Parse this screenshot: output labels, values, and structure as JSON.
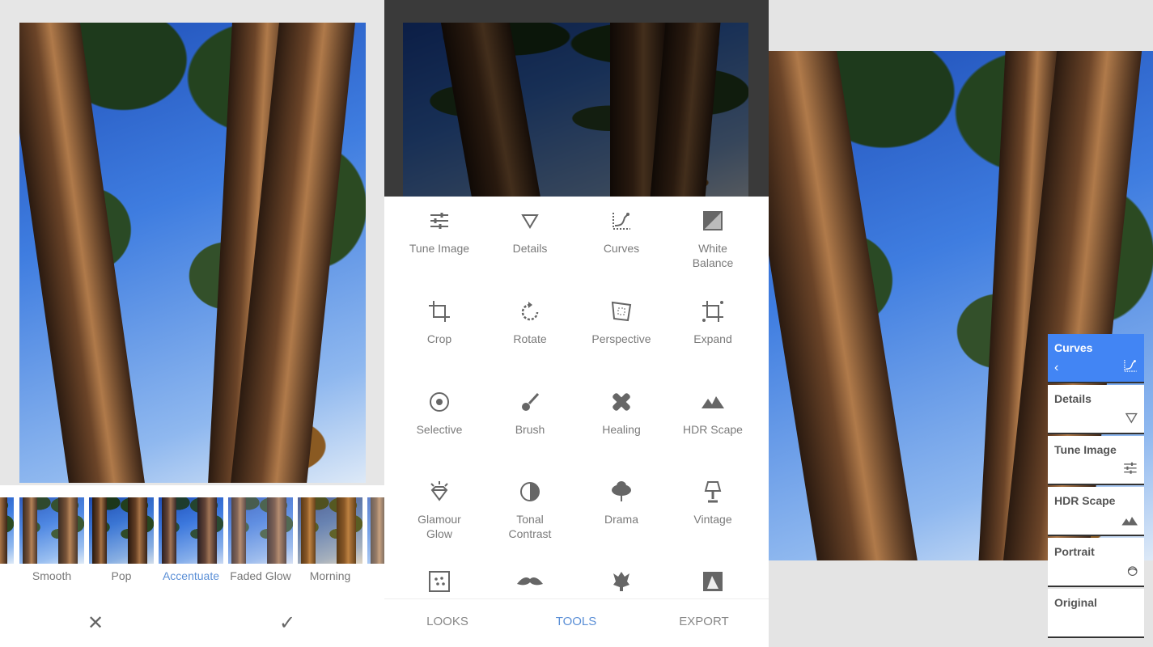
{
  "looks_screen": {
    "filters": [
      {
        "label": "t"
      },
      {
        "label": "Smooth"
      },
      {
        "label": "Pop"
      },
      {
        "label": "Accentuate",
        "active": true
      },
      {
        "label": "Faded Glow"
      },
      {
        "label": "Morning"
      },
      {
        "label": ""
      }
    ],
    "cancel_icon": "close-icon",
    "apply_icon": "check-icon"
  },
  "tools_screen": {
    "tools": [
      {
        "label": "Tune Image",
        "icon": "sliders-icon"
      },
      {
        "label": "Details",
        "icon": "triangle-down-icon"
      },
      {
        "label": "Curves",
        "icon": "curves-icon"
      },
      {
        "label": "White Balance",
        "icon": "white-balance-icon"
      },
      {
        "label": "Crop",
        "icon": "crop-icon"
      },
      {
        "label": "Rotate",
        "icon": "rotate-icon"
      },
      {
        "label": "Perspective",
        "icon": "perspective-icon"
      },
      {
        "label": "Expand",
        "icon": "expand-icon"
      },
      {
        "label": "Selective",
        "icon": "target-icon"
      },
      {
        "label": "Brush",
        "icon": "brush-icon"
      },
      {
        "label": "Healing",
        "icon": "bandage-icon"
      },
      {
        "label": "HDR Scape",
        "icon": "mountains-icon"
      },
      {
        "label": "Glamour Glow",
        "icon": "diamond-icon"
      },
      {
        "label": "Tonal Contrast",
        "icon": "contrast-icon"
      },
      {
        "label": "Drama",
        "icon": "cloud-icon"
      },
      {
        "label": "Vintage",
        "icon": "lamp-icon"
      },
      {
        "label": "",
        "icon": "grain-icon"
      },
      {
        "label": "",
        "icon": "mustache-icon"
      },
      {
        "label": "",
        "icon": "dragon-icon"
      },
      {
        "label": "",
        "icon": "frame-icon"
      }
    ],
    "nav": [
      {
        "label": "LOOKS"
      },
      {
        "label": "TOOLS",
        "active": true
      },
      {
        "label": "EXPORT"
      }
    ]
  },
  "stack_screen": {
    "edits": [
      {
        "label": "Curves",
        "icon": "curves-icon",
        "active": true
      },
      {
        "label": "Details",
        "icon": "triangle-down-icon"
      },
      {
        "label": "Tune Image",
        "icon": "sliders-icon"
      },
      {
        "label": "HDR Scape",
        "icon": "mountains-icon"
      },
      {
        "label": "Portrait",
        "icon": "face-icon"
      },
      {
        "label": "Original",
        "icon": ""
      }
    ]
  },
  "colors": {
    "accent": "#4285f4",
    "active_text": "#5b8fd6",
    "icon": "#666666"
  }
}
